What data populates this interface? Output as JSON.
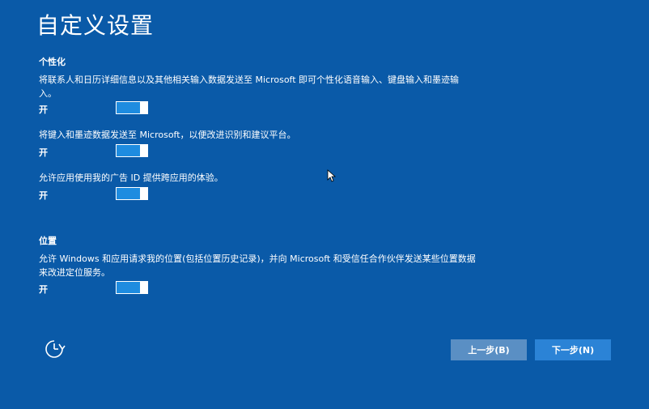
{
  "page": {
    "title": "自定义设置"
  },
  "personalization": {
    "heading": "个性化",
    "items": [
      {
        "description": "将联系人和日历详细信息以及其他相关输入数据发送至 Microsoft 即可个性化语音输入、键盘输入和墨迹输入。",
        "state": "开",
        "enabled": true
      },
      {
        "description": "将键入和墨迹数据发送至 Microsoft，以便改进识别和建议平台。",
        "state": "开",
        "enabled": true
      },
      {
        "description": "允许应用使用我的广告 ID 提供跨应用的体验。",
        "state": "开",
        "enabled": true
      }
    ]
  },
  "location": {
    "heading": "位置",
    "items": [
      {
        "description": "允许 Windows 和应用请求我的位置(包括位置历史记录)，并向 Microsoft 和受信任合作伙伴发送某些位置数据来改进定位服务。",
        "state": "开",
        "enabled": true
      }
    ]
  },
  "buttons": {
    "back_label": "上一步(B)",
    "next_label": "下一步(N)"
  },
  "icons": {
    "accessibility": "ease-of-access-icon",
    "cursor": "mouse-pointer-icon"
  },
  "colors": {
    "background": "#0a5aa8",
    "toggle_on": "#1e8ce0",
    "back_button": "#5a8fc4",
    "next_button": "#2b83d6"
  }
}
